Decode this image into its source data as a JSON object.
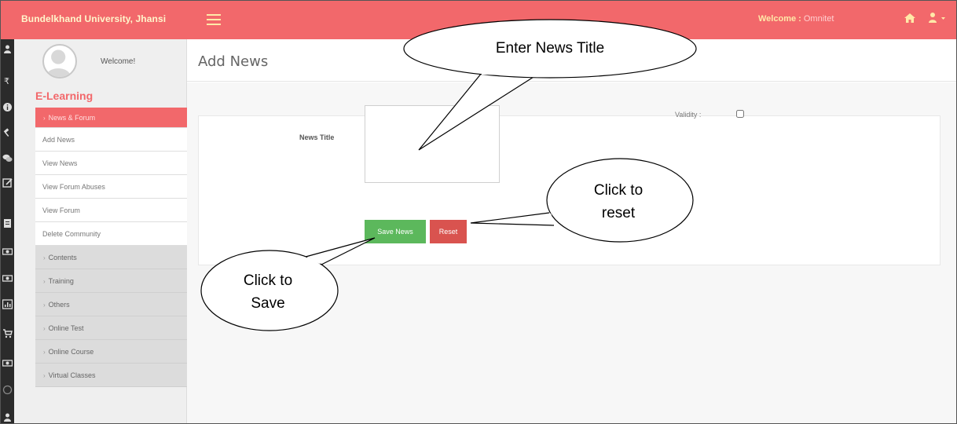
{
  "header": {
    "brand": "Bundelkhand University, Jhansi",
    "welcome_prefix": "Welcome : ",
    "welcome_user": "Omnitet"
  },
  "sidebar": {
    "welcome": "Welcome!",
    "section_title": "E-Learning",
    "active_item": "News & Forum",
    "sub_items": [
      "Add News",
      "View News",
      "View Forum Abuses",
      "View Forum",
      "Delete Community"
    ],
    "groups": [
      "Contents",
      "Training",
      "Others",
      "Online Test",
      "Online Course",
      "Virtual Classes"
    ]
  },
  "main": {
    "title": "Add News",
    "form": {
      "news_title_label": "News Title",
      "news_title_value": "",
      "validity_label": "Validity :",
      "validity_checked": false,
      "save_label": "Save News",
      "reset_label": "Reset"
    }
  },
  "callouts": {
    "title": "Enter News Title",
    "reset_line1": "Click to",
    "reset_line2": "reset",
    "save_line1": "Click to",
    "save_line2": "Save"
  },
  "colors": {
    "brand": "#f2686b",
    "save": "#5cb85c",
    "reset": "#d9534f"
  },
  "icons": {
    "menu": "hamburger-icon",
    "home": "home-icon",
    "user": "user-icon"
  }
}
